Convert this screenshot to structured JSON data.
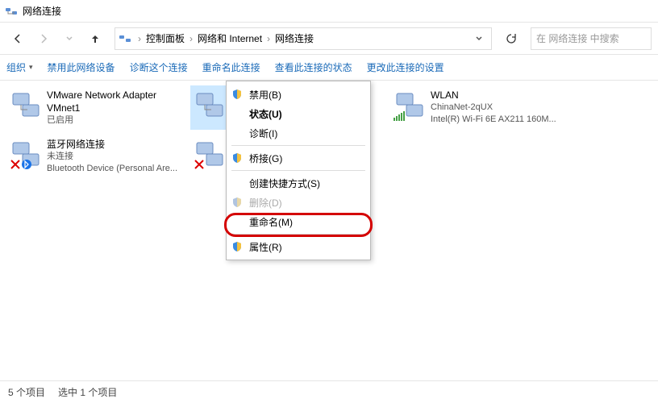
{
  "title": "网络连接",
  "breadcrumb": {
    "seg1": "控制面板",
    "seg2": "网络和 Internet",
    "seg3": "网络连接"
  },
  "search": {
    "placeholder": "在 网络连接 中搜索"
  },
  "toolbar": {
    "organize": "组织",
    "disable": "禁用此网络设备",
    "diagnose": "诊断这个连接",
    "rename": "重命名此连接",
    "viewStatus": "查看此连接的状态",
    "changeSettings": "更改此连接的设置"
  },
  "adapters": [
    {
      "title": "VMware Network Adapter VMnet1",
      "sub": "已启用",
      "dev": ""
    },
    {
      "title": "",
      "sub": "",
      "dev": ""
    },
    {
      "title": "WLAN",
      "sub": "ChinaNet-2qUX",
      "dev": "Intel(R) Wi-Fi 6E AX211 160M..."
    },
    {
      "title": "蓝牙网络连接",
      "sub": "未连接",
      "dev": "Bluetooth Device (Personal Are..."
    }
  ],
  "ctx": {
    "disable": "禁用(B)",
    "status": "状态(U)",
    "diagnose": "诊断(I)",
    "bridge": "桥接(G)",
    "shortcut": "创建快捷方式(S)",
    "delete": "删除(D)",
    "rename": "重命名(M)",
    "properties": "属性(R)"
  },
  "statusbar": {
    "count": "5 个项目",
    "selected": "选中 1 个项目"
  }
}
